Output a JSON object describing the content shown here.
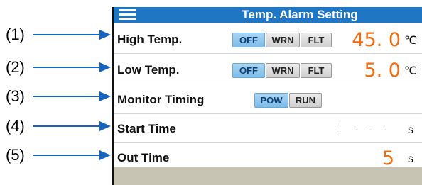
{
  "callouts": [
    "(1)",
    "(2)",
    "(3)",
    "(4)",
    "(5)"
  ],
  "header": {
    "title": "Temp. Alarm Setting",
    "menu_icon": "hamburger-menu-icon"
  },
  "rows": [
    {
      "label": "High Temp.",
      "options": [
        "OFF",
        "WRN",
        "FLT"
      ],
      "selected": "OFF",
      "value": "45. 0",
      "unit": "℃"
    },
    {
      "label": "Low Temp.",
      "options": [
        "OFF",
        "WRN",
        "FLT"
      ],
      "selected": "OFF",
      "value": "5. 0",
      "unit": "℃"
    },
    {
      "label": "Monitor Timing",
      "options": [
        "POW",
        "RUN"
      ],
      "selected": "POW"
    },
    {
      "label": "Start Time",
      "value": "- - -",
      "unit": "s"
    },
    {
      "label": "Out Time",
      "value": "5",
      "unit": "s"
    }
  ],
  "colors": {
    "accent": "#1f77c4",
    "value": "#f36b10",
    "selected_button": "#7ebce8",
    "footer": "#c8c4b4",
    "arrow": "#1565c0"
  }
}
